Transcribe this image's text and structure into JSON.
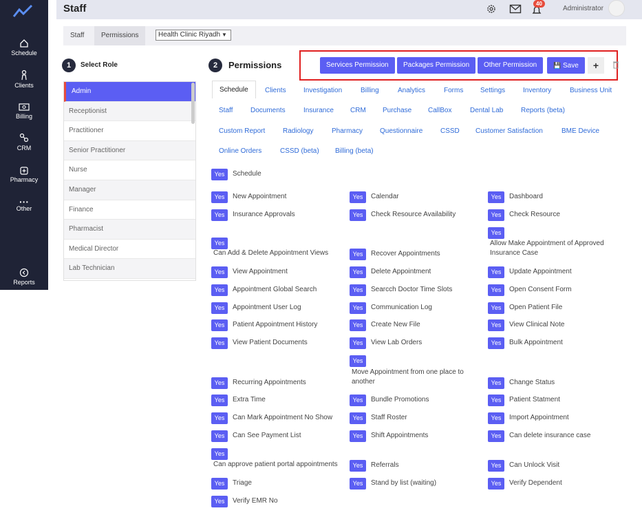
{
  "sidebar": {
    "items": [
      {
        "label": "Schedule",
        "icon": "home-icon"
      },
      {
        "label": "Clients",
        "icon": "person-icon"
      },
      {
        "label": "Billing",
        "icon": "money-icon"
      },
      {
        "label": "CRM",
        "icon": "crm-icon"
      },
      {
        "label": "Pharmacy",
        "icon": "pharmacy-icon"
      },
      {
        "label": "Other",
        "icon": "more-icon"
      },
      {
        "label": "Reports",
        "icon": "reports-icon"
      }
    ]
  },
  "header": {
    "title": "Staff",
    "notification_count": "40",
    "user_name": "Administrator"
  },
  "subtabs": [
    "Staff",
    "Permissions"
  ],
  "clinic_select": "Health Clinic Riyadh",
  "role_panel": {
    "step": "1",
    "title": "Select Role",
    "roles": [
      "Admin",
      "Receptionist",
      "Practitioner",
      "Senior Practitioner",
      "Nurse",
      "Manager",
      "Finance",
      "Pharmacist",
      "Medical Director",
      "Lab Technician"
    ]
  },
  "perm_panel": {
    "step": "2",
    "title": "Permissions",
    "buttons": {
      "services": "Services Permission",
      "packages": "Packages Permission",
      "other": "Other Permission",
      "save": "Save",
      "add": "+"
    },
    "tabs_row1": [
      "Schedule",
      "Clients",
      "Investigation",
      "Billing",
      "Analytics",
      "Forms",
      "Settings",
      "Inventory",
      "Business Unit"
    ],
    "tabs_row2": [
      "Staff",
      "Documents",
      "Insurance",
      "CRM",
      "Purchase",
      "CallBox",
      "Dental Lab",
      "Reports (beta)"
    ],
    "tabs_row3": [
      "Custom Report",
      "Radiology",
      "Pharmacy",
      "Questionnaire",
      "CSSD",
      "Customer Satisfaction",
      "BME Device"
    ],
    "tabs_row4": [
      "Online Orders",
      "CSSD (beta)",
      "Billing (beta)"
    ],
    "yes_label": "Yes",
    "section": "Schedule",
    "perms": [
      "New Appointment",
      "Calendar",
      "Dashboard",
      "Insurance Approvals",
      "Check Resource Availability",
      "Check Resource",
      "Can Add & Delete Appointment Views",
      "Recover Appointments",
      "Allow Make Appointment of Approved Insurance Case",
      "View Appointment",
      "Delete Appointment",
      "Update Appointment",
      "Appointment Global Search",
      "Searcch Doctor Time Slots",
      "Open Consent Form",
      "Appointment User Log",
      "Communication Log",
      "Open Patient File",
      "Patient Appointment History",
      "Create New File",
      "View Clinical Note",
      "View Patient Documents",
      "View Lab Orders",
      "Bulk Appointment",
      "Recurring Appointments",
      "Move Appointment from one place to another",
      "Change Status",
      "Extra Time",
      "Bundle Promotions",
      "Patient Statment",
      "Can Mark Appointment No Show",
      "Staff Roster",
      "Import Appointment",
      "Can See Payment List",
      "Shift Appointments",
      "Can delete insurance case",
      "Can approve patient portal appointments",
      "Referrals",
      "Can Unlock Visit",
      "Triage",
      "Stand by list (waiting)",
      "Verify Dependent",
      "Verify EMR No"
    ]
  }
}
